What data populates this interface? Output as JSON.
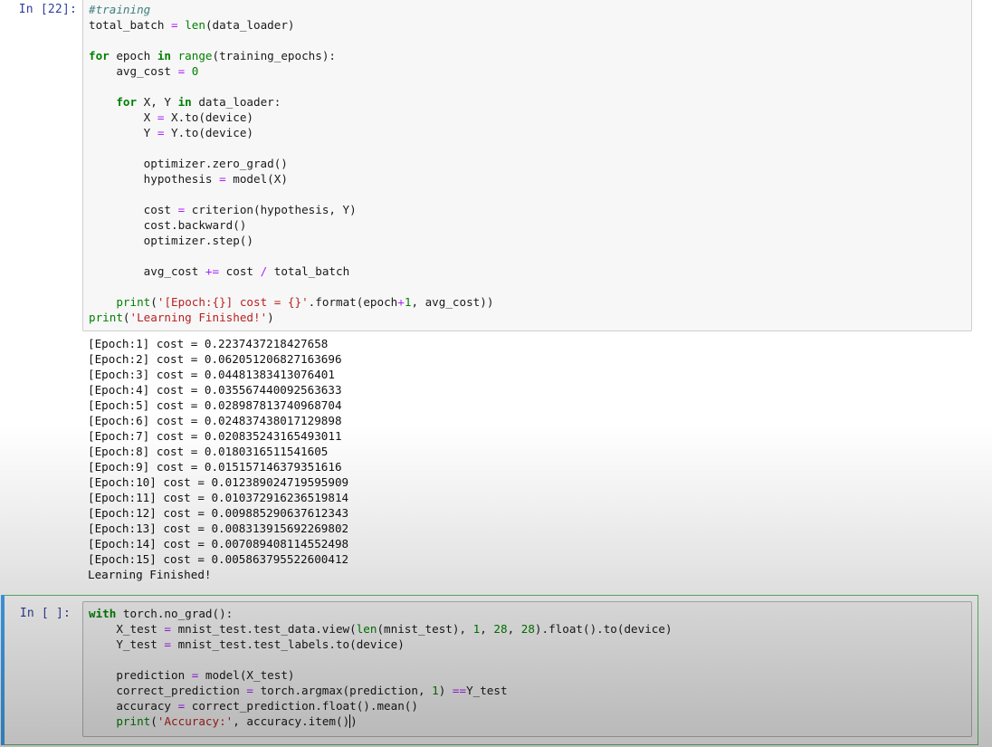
{
  "cells": [
    {
      "prompt": "In [22]:",
      "code": [
        [
          {
            "t": "#training",
            "c": "cm"
          }
        ],
        [
          {
            "t": "total_batch "
          },
          {
            "t": "=",
            "c": "op"
          },
          {
            "t": " "
          },
          {
            "t": "len",
            "c": "bi"
          },
          {
            "t": "(data_loader)"
          }
        ],
        [],
        [
          {
            "t": "for",
            "c": "kw"
          },
          {
            "t": " epoch "
          },
          {
            "t": "in",
            "c": "kw"
          },
          {
            "t": " "
          },
          {
            "t": "range",
            "c": "bi"
          },
          {
            "t": "(training_epochs):"
          }
        ],
        [
          {
            "t": "    avg_cost "
          },
          {
            "t": "=",
            "c": "op"
          },
          {
            "t": " "
          },
          {
            "t": "0",
            "c": "num"
          }
        ],
        [],
        [
          {
            "t": "    "
          },
          {
            "t": "for",
            "c": "kw"
          },
          {
            "t": " X, Y "
          },
          {
            "t": "in",
            "c": "kw"
          },
          {
            "t": " data_loader:"
          }
        ],
        [
          {
            "t": "        X "
          },
          {
            "t": "=",
            "c": "op"
          },
          {
            "t": " X.to(device)"
          }
        ],
        [
          {
            "t": "        Y "
          },
          {
            "t": "=",
            "c": "op"
          },
          {
            "t": " Y.to(device)"
          }
        ],
        [],
        [
          {
            "t": "        optimizer.zero_grad()"
          }
        ],
        [
          {
            "t": "        hypothesis "
          },
          {
            "t": "=",
            "c": "op"
          },
          {
            "t": " model(X)"
          }
        ],
        [],
        [
          {
            "t": "        cost "
          },
          {
            "t": "=",
            "c": "op"
          },
          {
            "t": " criterion(hypothesis, Y)"
          }
        ],
        [
          {
            "t": "        cost.backward()"
          }
        ],
        [
          {
            "t": "        optimizer.step()"
          }
        ],
        [],
        [
          {
            "t": "        avg_cost "
          },
          {
            "t": "+=",
            "c": "op"
          },
          {
            "t": " cost "
          },
          {
            "t": "/",
            "c": "op"
          },
          {
            "t": " total_batch"
          }
        ],
        [],
        [
          {
            "t": "    "
          },
          {
            "t": "print",
            "c": "bi"
          },
          {
            "t": "("
          },
          {
            "t": "'[Epoch:{}] cost = {}'",
            "c": "str"
          },
          {
            "t": ".format(epoch"
          },
          {
            "t": "+",
            "c": "op"
          },
          {
            "t": "1",
            "c": "num"
          },
          {
            "t": ", avg_cost))"
          }
        ],
        [
          {
            "t": "print",
            "c": "bi"
          },
          {
            "t": "("
          },
          {
            "t": "'Learning Finished!'",
            "c": "str"
          },
          {
            "t": ")"
          }
        ]
      ],
      "output": [
        "[Epoch:1] cost = 0.2237437218427658",
        "[Epoch:2] cost = 0.062051206827163696",
        "[Epoch:3] cost = 0.04481383413076401",
        "[Epoch:4] cost = 0.035567440092563633",
        "[Epoch:5] cost = 0.028987813740968704",
        "[Epoch:6] cost = 0.024837438017129898",
        "[Epoch:7] cost = 0.020835243165493011",
        "[Epoch:8] cost = 0.0180316511541605",
        "[Epoch:9] cost = 0.015157146379351616",
        "[Epoch:10] cost = 0.012389024719595909",
        "[Epoch:11] cost = 0.010372916236519814",
        "[Epoch:12] cost = 0.009885290637612343",
        "[Epoch:13] cost = 0.008313915692269802",
        "[Epoch:14] cost = 0.007089408114552498",
        "[Epoch:15] cost = 0.005863795522600412",
        "Learning Finished!"
      ]
    },
    {
      "prompt": "In [ ]:",
      "code": [
        [
          {
            "t": "with",
            "c": "kw"
          },
          {
            "t": " torch.no_grad():"
          }
        ],
        [
          {
            "t": "    X_test "
          },
          {
            "t": "=",
            "c": "op"
          },
          {
            "t": " mnist_test.test_data.view("
          },
          {
            "t": "len",
            "c": "bi"
          },
          {
            "t": "(mnist_test), "
          },
          {
            "t": "1",
            "c": "num"
          },
          {
            "t": ", "
          },
          {
            "t": "28",
            "c": "num"
          },
          {
            "t": ", "
          },
          {
            "t": "28",
            "c": "num"
          },
          {
            "t": ").float().to(device)"
          }
        ],
        [
          {
            "t": "    Y_test "
          },
          {
            "t": "=",
            "c": "op"
          },
          {
            "t": " mnist_test.test_labels.to(device)"
          }
        ],
        [],
        [
          {
            "t": "    prediction "
          },
          {
            "t": "=",
            "c": "op"
          },
          {
            "t": " model(X_test)"
          }
        ],
        [
          {
            "t": "    correct_prediction "
          },
          {
            "t": "=",
            "c": "op"
          },
          {
            "t": " torch.argmax(prediction, "
          },
          {
            "t": "1",
            "c": "num"
          },
          {
            "t": ") "
          },
          {
            "t": "==",
            "c": "op"
          },
          {
            "t": "Y_test"
          }
        ],
        [
          {
            "t": "    accuracy "
          },
          {
            "t": "=",
            "c": "op"
          },
          {
            "t": " correct_prediction.float().mean()"
          }
        ],
        [
          {
            "t": "    "
          },
          {
            "t": "print",
            "c": "bi"
          },
          {
            "t": "("
          },
          {
            "t": "'Accuracy:'",
            "c": "str"
          },
          {
            "t": ", accuracy.item()"
          },
          {
            "t": ")",
            "cursor": true
          }
        ]
      ],
      "output": []
    }
  ]
}
